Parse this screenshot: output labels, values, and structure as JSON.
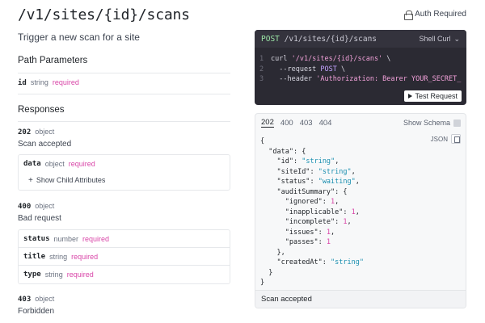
{
  "header": {
    "title": "/v1/sites/{id}/scans",
    "description": "Trigger a new scan for a site",
    "auth_label": "Auth Required"
  },
  "path_params": {
    "heading": "Path Parameters",
    "items": [
      {
        "name": "id",
        "type": "string",
        "required": "required"
      }
    ]
  },
  "responses": {
    "heading": "Responses",
    "r202": {
      "code": "202",
      "kind": "object",
      "desc": "Scan accepted",
      "attr_name": "data",
      "attr_type": "object",
      "attr_required": "required",
      "child_btn": "Show Child Attributes"
    },
    "r400": {
      "code": "400",
      "kind": "object",
      "desc": "Bad request",
      "rows": [
        {
          "name": "status",
          "type": "number",
          "required": "required"
        },
        {
          "name": "title",
          "type": "string",
          "required": "required"
        },
        {
          "name": "type",
          "type": "string",
          "required": "required"
        }
      ]
    },
    "r403": {
      "code": "403",
      "kind": "object",
      "desc": "Forbidden"
    }
  },
  "request_card": {
    "method": "POST",
    "path": "/v1/sites/{id}/scans",
    "lang": "Shell Curl",
    "lines": [
      {
        "n": "1",
        "a": "curl ",
        "b": "'/v1/sites/{id}/scans'",
        "c": " \\"
      },
      {
        "n": "2",
        "a": "  --request ",
        "b": "POST",
        "c": " \\"
      },
      {
        "n": "3",
        "a": "  --header ",
        "b": "'Authorization: Bearer YOUR_SECRET_",
        "c": ""
      }
    ],
    "test_btn": "Test Request"
  },
  "response_card": {
    "tabs": [
      "202",
      "400",
      "403",
      "404"
    ],
    "active_tab": "202",
    "show_schema": "Show Schema",
    "format": "JSON",
    "footer": "Scan accepted",
    "json": {
      "id": "string",
      "siteId": "string",
      "status": "waiting",
      "ignored": "1",
      "inapplicable": "1",
      "incomplete": "1",
      "issues": "1",
      "passes": "1",
      "createdAt": "string"
    }
  }
}
